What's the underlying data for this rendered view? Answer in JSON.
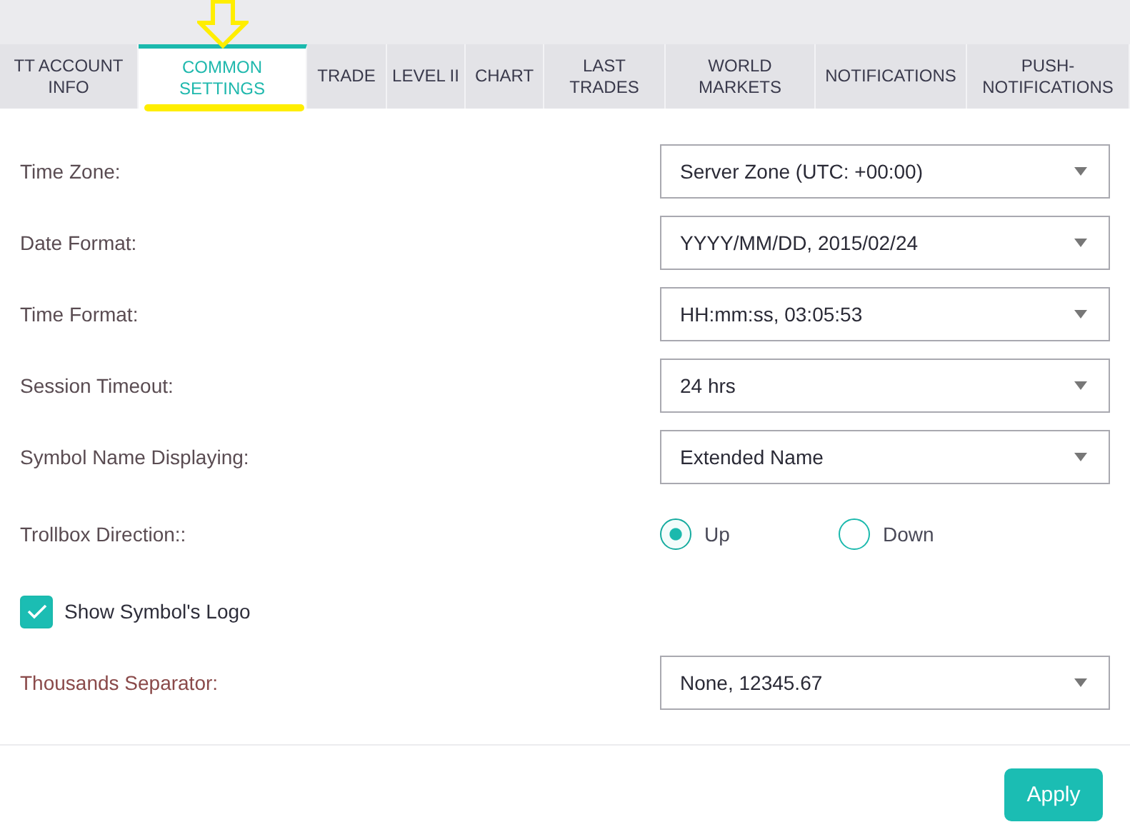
{
  "tabs": [
    {
      "label": "TT ACCOUNT INFO",
      "selected": false
    },
    {
      "label": "COMMON SETTINGS",
      "selected": true
    },
    {
      "label": "TRADE",
      "selected": false
    },
    {
      "label": "LEVEL II",
      "selected": false
    },
    {
      "label": "CHART",
      "selected": false
    },
    {
      "label": "LAST TRADES",
      "selected": false
    },
    {
      "label": "WORLD MARKETS",
      "selected": false
    },
    {
      "label": "NOTIFICATIONS",
      "selected": false
    },
    {
      "label": "PUSH-NOTIFICATIONS",
      "selected": false
    }
  ],
  "settings": [
    {
      "kind": "select",
      "label": "Time Zone:",
      "value": "Server Zone (UTC: +00:00)"
    },
    {
      "kind": "select",
      "label": "Date Format:",
      "value": "YYYY/MM/DD, 2015/02/24"
    },
    {
      "kind": "select",
      "label": "Time Format:",
      "value": "HH:mm:ss, 03:05:53"
    },
    {
      "kind": "select",
      "label": "Session Timeout:",
      "value": "24 hrs"
    },
    {
      "kind": "select",
      "label": "Symbol Name Displaying:",
      "value": "Extended Name"
    },
    {
      "kind": "radio",
      "label": "Trollbox Direction::",
      "options": [
        {
          "label": "Up",
          "selected": true
        },
        {
          "label": "Down",
          "selected": false
        }
      ]
    },
    {
      "kind": "checkbox",
      "label": "Show Symbol's Logo",
      "checked": true
    },
    {
      "kind": "select",
      "label": "Thousands Separator:",
      "value": "None, 12345.67"
    }
  ],
  "buttons": [
    "Apply"
  ]
}
